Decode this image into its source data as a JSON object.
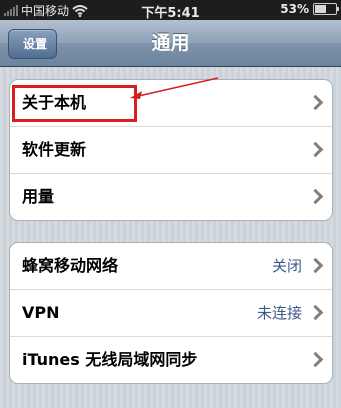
{
  "status_bar": {
    "carrier": "中国移动",
    "time": "下午5:41",
    "battery_text": "53%",
    "battery_level": 0.53
  },
  "nav": {
    "back_label": "设置",
    "title": "通用"
  },
  "group1": {
    "items": [
      {
        "label": "关于本机"
      },
      {
        "label": "软件更新"
      },
      {
        "label": "用量"
      }
    ]
  },
  "group2": {
    "items": [
      {
        "label": "蜂窝移动网络",
        "value": "关闭"
      },
      {
        "label": "VPN",
        "value": "未连接"
      },
      {
        "label": "iTunes 无线局域网同步"
      }
    ]
  },
  "colors": {
    "highlight": "#d62020",
    "value_text": "#3d5a86"
  },
  "icons": [
    "signal-icon",
    "wifi-icon",
    "battery-icon",
    "chevron-right-icon",
    "annotation-arrow-icon"
  ]
}
